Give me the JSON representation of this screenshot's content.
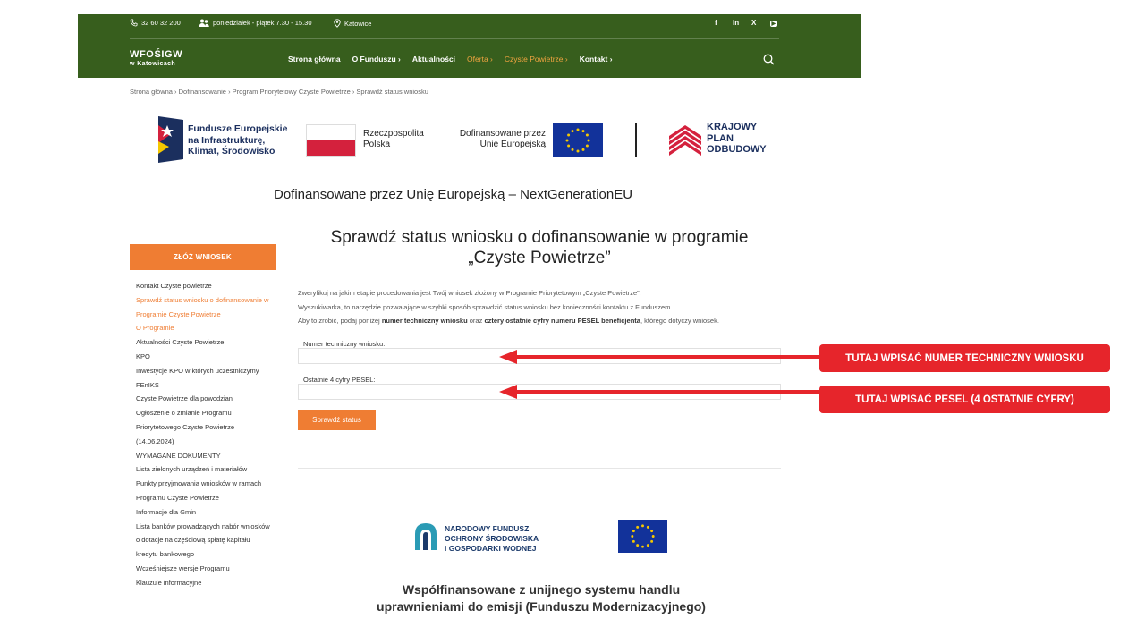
{
  "header": {
    "phone": "32 60 32 200",
    "hours": "poniedziałek - piątek 7.30 - 15.30",
    "location": "Katowice",
    "social": [
      "f",
      "in",
      "X",
      "▶"
    ],
    "logo_line1": "WFOŚIGW",
    "logo_line2": "w Katowicach",
    "nav": [
      {
        "label": "Strona główna"
      },
      {
        "label": "O Funduszu ›"
      },
      {
        "label": "Aktualności"
      },
      {
        "label": "Oferta ›"
      },
      {
        "label": "Czyste Powietrze ›"
      },
      {
        "label": "Kontakt ›"
      }
    ],
    "colors": {
      "bar": "#375e1d",
      "accent": "#ef7d33"
    }
  },
  "breadcrumb": "Strona główna › Dofinansowanie › Program Priorytetowy Czyste Powietrze › Sprawdź status wniosku",
  "eu_band": {
    "fe": [
      "Fundusze Europejskie",
      "na Infrastrukturę,",
      "Klimat, Środowisko"
    ],
    "rp": [
      "Rzeczpospolita",
      "Polska"
    ],
    "ue": [
      "Dofinansowane przez",
      "Unię Europejską"
    ],
    "kpo": [
      "KRAJOWY",
      "PLAN",
      "ODBUDOWY"
    ]
  },
  "ngeu": "Dofinansowane przez Unię Europejską – NextGenerationEU",
  "sidebar": {
    "apply_label": "ZŁÓŻ WNIOSEK",
    "items": [
      {
        "label": "Kontakt Czyste powietrze"
      },
      {
        "label": "Sprawdź status wniosku o dofinansowanie w"
      },
      {
        "label": "Programie Czyste Powietrze"
      },
      {
        "label": "O Programie"
      },
      {
        "label": "Aktualności Czyste Powietrze"
      },
      {
        "label": "KPO"
      },
      {
        "label": "Inwestycje KPO w których uczestniczymy"
      },
      {
        "label": "FEnIKS"
      },
      {
        "label": "Czyste Powietrze dla powodzian"
      },
      {
        "label": "Ogłoszenie o zmianie Programu"
      },
      {
        "label": "Priorytetowego Czyste Powietrze"
      },
      {
        "label": "(14.06.2024)"
      },
      {
        "label": "WYMAGANE DOKUMENTY"
      },
      {
        "label": "Lista zielonych urządzeń i materiałów"
      },
      {
        "label": "Punkty przyjmowania wniosków w ramach"
      },
      {
        "label": "Programu Czyste Powietrze"
      },
      {
        "label": "Informacje dla Gmin"
      },
      {
        "label": "Lista banków prowadzących nabór wniosków"
      },
      {
        "label": "o dotacje na częściową spłatę kapitału"
      },
      {
        "label": "kredytu bankowego"
      },
      {
        "label": "Wcześniejsze wersje Programu"
      },
      {
        "label": "Klauzule informacyjne"
      }
    ]
  },
  "main": {
    "title_line1": "Sprawdź status wniosku o dofinansowanie w programie",
    "title_line2": "„Czyste Powietrze”",
    "intro_line1": "Zweryfikuj na jakim etapie procedowania jest Twój wniosek złożony w Programie Priorytetowym „Czyste Powietrze”.",
    "intro_line2": "Wyszukiwarka, to narzędzie pozwalające w szybki sposób sprawdzić status wniosku bez konieczności kontaktu z Funduszem.",
    "intro_line3_a": "Aby to zrobić, podaj poniżej ",
    "intro_line3_b": "numer techniczny wniosku",
    "intro_line3_c": " oraz ",
    "intro_line3_d": "cztery ostatnie cyfry numeru PESEL beneficjenta",
    "intro_line3_e": ", którego dotyczy wniosek.",
    "field1_label": "Numer techniczny wniosku:",
    "field1_value": "",
    "field2_label": "Ostatnie 4 cyfry PESEL:",
    "field2_value": "",
    "submit_label": "Sprawdź status"
  },
  "callouts": {
    "c1": "TUTAJ WPISAĆ NUMER TECHNICZNY WNIOSKU",
    "c2": "TUTAJ WPISAĆ PESEL (4 OSTATNIE CYFRY)"
  },
  "footer": {
    "nfos": [
      "NARODOWY FUNDUSZ",
      "OCHRONY ŚRODOWISKA",
      "i GOSPODARKI WODNEJ"
    ],
    "cofin_line1": "Współfinansowane z unijnego systemu handlu",
    "cofin_line2": "uprawnieniami do emisji (Funduszu Modernizacyjnego)"
  }
}
